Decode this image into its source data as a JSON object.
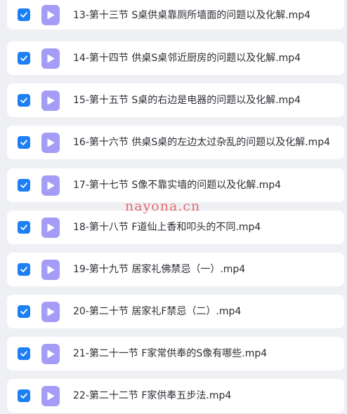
{
  "colors": {
    "checkbox": "#1d7ff4",
    "file_icon": "#a49cf7",
    "row_background": "#ffffff",
    "page_background": "#eef0f4",
    "watermark": "#e25454"
  },
  "icons": {
    "checkbox": "checkmark-icon",
    "file": "video-play-icon"
  },
  "files": [
    {
      "name": "13-第十三节 S桌供桌靠厕所墙面的问题以及化解.mp4",
      "checked": true
    },
    {
      "name": "14-第十四节 供桌S桌邻近厨房的问题以及化解.mp4",
      "checked": true
    },
    {
      "name": "15-第十五节 S桌的右边是电器的问题以及化解.mp4",
      "checked": true
    },
    {
      "name": "16-第十六节 供桌S桌的左边太过杂乱的问题以及化解.mp4",
      "checked": true
    },
    {
      "name": "17-第十七节 S像不靠实墙的问题以及化解.mp4",
      "checked": true
    },
    {
      "name": "18-第十八节 F道仙上香和叩头的不同.mp4",
      "checked": true
    },
    {
      "name": "19-第十九节 居家礼佛禁忌（一）.mp4",
      "checked": true
    },
    {
      "name": "20-第二十节 居家礼F禁忌（二）.mp4",
      "checked": true
    },
    {
      "name": "21-第二十一节 F家常供奉的S像有哪些.mp4",
      "checked": true
    },
    {
      "name": "22-第二十二节 F家供奉五步法.mp4",
      "checked": true
    }
  ],
  "watermark": {
    "text": "nayona.cn"
  }
}
